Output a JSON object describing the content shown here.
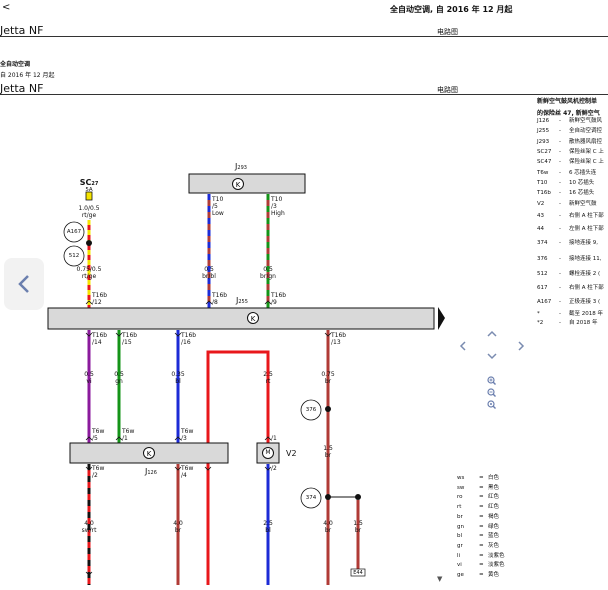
{
  "header": {
    "back_glyph": "<",
    "title": "全自动空调, 自 2016 年 12 月起",
    "model": "Jetta NF",
    "section": "电路图"
  },
  "subheader": {
    "line1": "全自动空调",
    "line2": "自 2016 年 12 月起",
    "model": "Jetta NF",
    "section": "电路图"
  },
  "right_panel": {
    "heading1": "新鲜空气鼓风机控制单",
    "heading2": "的保险丝 47, 新鲜空气",
    "rows": [
      {
        "code": "J126",
        "dash": "-",
        "text": "新鲜空气鼓风"
      },
      {
        "code": "J255",
        "dash": "-",
        "text": "全自动空调控"
      },
      {
        "code": "J293",
        "dash": "-",
        "text": "散热器风扇控"
      },
      {
        "code": "SC27",
        "dash": "-",
        "text": "保险丝架 C 上"
      },
      {
        "code": "SC47",
        "dash": "-",
        "text": "保险丝架 C 上"
      },
      {
        "code": "T6w",
        "dash": "-",
        "text": "6 芯插头连"
      },
      {
        "code": "T10",
        "dash": "-",
        "text": "10 芯插头"
      },
      {
        "code": "T16b",
        "dash": "-",
        "text": "16 芯插头"
      },
      {
        "code": "V2",
        "dash": "-",
        "text": "新鲜空气鼓"
      },
      {
        "code": "43",
        "dash": "-",
        "text": "右侧 A 柱下部"
      },
      {
        "code": "44",
        "dash": "-",
        "text": "左侧 A 柱下部"
      },
      {
        "code": "374",
        "dash": "-",
        "text": "接地连接 9,"
      },
      {
        "code": "376",
        "dash": "-",
        "text": "接地连接 11,"
      },
      {
        "code": "512",
        "dash": "-",
        "text": "螺栓连接 2 ("
      },
      {
        "code": "617",
        "dash": "-",
        "text": "右侧 A 柱下部"
      },
      {
        "code": "A167",
        "dash": "-",
        "text": "正极连接 3 ("
      },
      {
        "code": "*",
        "dash": "-",
        "text": "截至 2018 年"
      },
      {
        "code": "*2",
        "dash": "-",
        "text": "自 2018 年"
      }
    ]
  },
  "legend": [
    {
      "code": "ws",
      "name": "白色"
    },
    {
      "code": "sw",
      "name": "黑色"
    },
    {
      "code": "ro",
      "name": "红色"
    },
    {
      "code": "rt",
      "name": "红色"
    },
    {
      "code": "br",
      "name": "褐色"
    },
    {
      "code": "gn",
      "name": "绿色"
    },
    {
      "code": "bl",
      "name": "蓝色"
    },
    {
      "code": "gr",
      "name": "灰色"
    },
    {
      "code": "li",
      "name": "淡紫色"
    },
    {
      "code": "vi",
      "name": "淡紫色"
    },
    {
      "code": "ge",
      "name": "黄色"
    }
  ],
  "diagram": {
    "sc27": {
      "name": "SC",
      "sub": "27",
      "rating": "5A"
    },
    "wire_sc27": {
      "size": "1.0/0.5",
      "color": "rt/ge"
    },
    "a167": "A167",
    "n512": "512",
    "wire_j255_t12": {
      "size": "0.75/0.5",
      "color": "rt/ge",
      "pin": "T16b",
      "pinno": "/12"
    },
    "j293": {
      "name": "J",
      "sub": "293"
    },
    "t10_5": {
      "pin": "T10",
      "pinno": "/5",
      "note": "Low"
    },
    "t10_3": {
      "pin": "T10",
      "pinno": "/3",
      "note": "High"
    },
    "wire_brbl": {
      "size": "0.5",
      "color": "br/bl",
      "pin": "T16b",
      "pinno": "/8"
    },
    "wire_brgn": {
      "size": "0.5",
      "color": "br/gn",
      "pin": "T16b",
      "pinno": "/9"
    },
    "j255": {
      "name": "J",
      "sub": "255"
    },
    "w14": {
      "pin": "T16b",
      "pinno": "/14",
      "size": "0.5",
      "color": "vi",
      "pin2": "T6w",
      "pinno2": "/5"
    },
    "w15": {
      "pin": "T16b",
      "pinno": "/15",
      "size": "0.5",
      "color": "gn",
      "pin2": "T6w",
      "pinno2": "/1"
    },
    "w16": {
      "pin": "T16b",
      "pinno": "/16",
      "size": "0.35",
      "color": "bl",
      "pin2": "T6w",
      "pinno2": "/3"
    },
    "w13": {
      "pin": "T16b",
      "pinno": "/13",
      "size": "0.75",
      "color": "br"
    },
    "wrt": {
      "size": "2.5",
      "color": "rt",
      "pinno": "/1"
    },
    "n376": "376",
    "n374": "374",
    "j126": {
      "name": "J",
      "sub": "126"
    },
    "v2": "V2",
    "v2_m": "M",
    "t6w_2": {
      "pin": "T6w",
      "pinno": "/2"
    },
    "t6w_4": {
      "pin": "T6w",
      "pinno": "/4"
    },
    "v2_2": "/2",
    "w_br15": {
      "size": "1.5",
      "color": "br"
    },
    "w_swrt": {
      "size": "4.0",
      "color": "sw/rt"
    },
    "w_br40": {
      "size": "4.0",
      "color": "br"
    },
    "w_bl25": {
      "size": "2.5",
      "color": "bl"
    },
    "w_br40b": {
      "size": "4.0",
      "color": "br"
    },
    "w_br15b": {
      "size": "1.5",
      "color": "br"
    },
    "e44": "E44"
  },
  "colors": {
    "red": "#e8171b",
    "blue": "#1c2bd6",
    "green": "#149418",
    "violet": "#8b1a9c",
    "brown": "#b03b36",
    "yellow": "#f5e400",
    "black": "#111111",
    "gray_box": "#d9d9d9"
  }
}
